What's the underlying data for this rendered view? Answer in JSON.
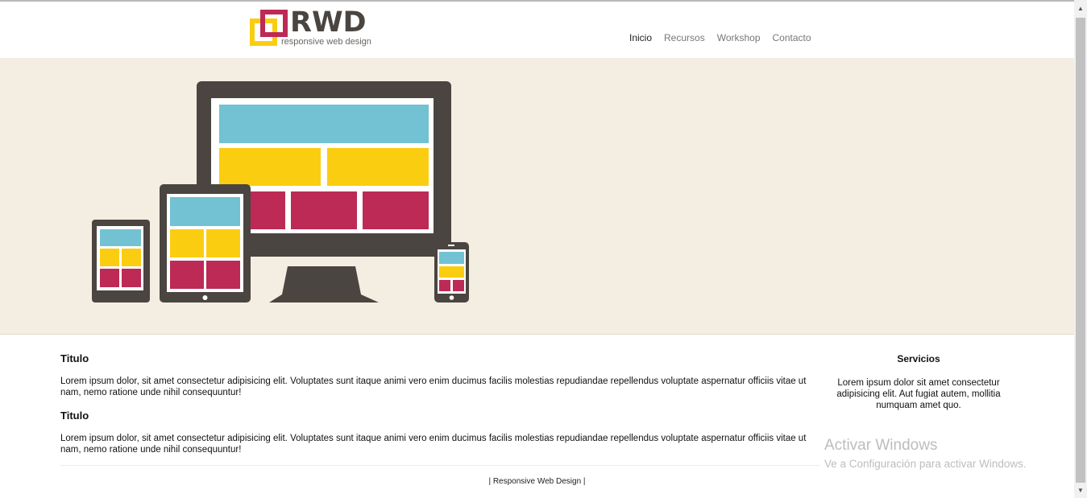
{
  "header": {
    "logo_text": "RWD",
    "logo_subtitle": "responsive web design",
    "nav": [
      {
        "label": "Inicio",
        "active": true
      },
      {
        "label": "Recursos",
        "active": false
      },
      {
        "label": "Workshop",
        "active": false
      },
      {
        "label": "Contacto",
        "active": false
      }
    ]
  },
  "colors": {
    "hero_bg": "#f4ede1",
    "device_dark": "#4a4540",
    "blue": "#72c2d3",
    "yellow": "#fbcd11",
    "magenta": "#bc2a55"
  },
  "main": {
    "articles": [
      {
        "title": "Titulo",
        "text": "Lorem ipsum dolor, sit amet consectetur adipisicing elit. Voluptates sunt itaque animi vero enim ducimus facilis molestias repudiandae repellendus voluptate aspernatur officiis vitae ut nam, nemo ratione unde nihil consequuntur!"
      },
      {
        "title": "Titulo",
        "text": "Lorem ipsum dolor, sit amet consectetur adipisicing elit. Voluptates sunt itaque animi vero enim ducimus facilis molestias repudiandae repellendus voluptate aspernatur officiis vitae ut nam, nemo ratione unde nihil consequuntur!"
      }
    ]
  },
  "aside": {
    "title": "Servicios",
    "text": "Lorem ipsum dolor sit amet consectetur adipisicing elit. Aut fugiat autem, mollitia numquam amet quo."
  },
  "footer": {
    "text": "| Responsive Web Design |"
  },
  "watermark": {
    "title": "Activar Windows",
    "subtitle": "Ve a Configuración para activar Windows."
  }
}
